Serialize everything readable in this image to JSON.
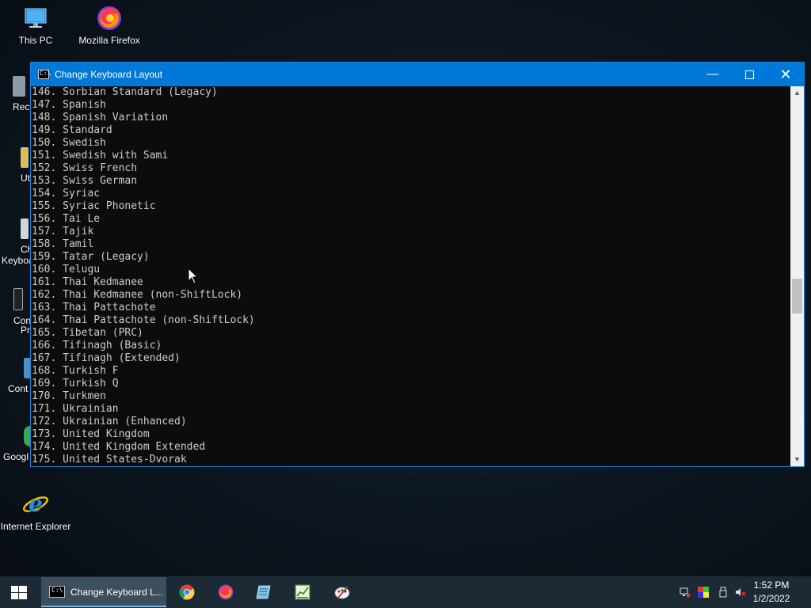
{
  "desktop": {
    "icons": [
      {
        "label": "This PC",
        "icon": "computer-icon"
      },
      {
        "label": "Mozilla Firefox",
        "icon": "firefox-icon"
      },
      {
        "label": "Internet Explorer",
        "icon": "internet-explorer-icon"
      }
    ],
    "partial_labels": [
      "Recy",
      "Ut",
      "Ch",
      "Keyboa",
      "Con",
      "Pr",
      "Cont",
      "Googl"
    ]
  },
  "window": {
    "title": "Change Keyboard Layout",
    "minimize": "—",
    "close": "✕",
    "lines": [
      "146. Sorbian Standard (Legacy)",
      "147. Spanish",
      "148. Spanish Variation",
      "149. Standard",
      "150. Swedish",
      "151. Swedish with Sami",
      "152. Swiss French",
      "153. Swiss German",
      "154. Syriac",
      "155. Syriac Phonetic",
      "156. Tai Le",
      "157. Tajik",
      "158. Tamil",
      "159. Tatar (Legacy)",
      "160. Telugu",
      "161. Thai Kedmanee",
      "162. Thai Kedmanee (non-ShiftLock)",
      "163. Thai Pattachote",
      "164. Thai Pattachote (non-ShiftLock)",
      "165. Tibetan (PRC)",
      "166. Tifinagh (Basic)",
      "167. Tifinagh (Extended)",
      "168. Turkish F",
      "169. Turkish Q",
      "170. Turkmen",
      "171. Ukrainian",
      "172. Ukrainian (Enhanced)",
      "173. United Kingdom",
      "174. United Kingdom Extended",
      "175. United States-Dvorak"
    ],
    "scroll_position": 0.56
  },
  "taskbar": {
    "active_window_label": "Change Keyboard L...",
    "pinned_apps": [
      "chrome-icon",
      "firefox-icon",
      "notepad-icon",
      "spreadsheet-icon",
      "paint-icon"
    ],
    "clock_time": "1:52 PM",
    "clock_date": "1/2/2022"
  },
  "colors": {
    "titlebar": "#0078d7",
    "console_bg": "#0c0c0c",
    "console_text": "#cccccc",
    "taskbar": "#1c2a35"
  }
}
